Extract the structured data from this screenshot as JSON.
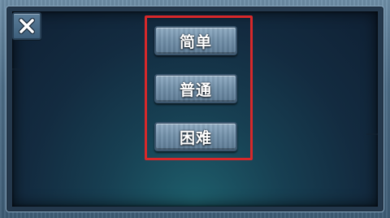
{
  "dialog": {
    "close_icon": "close-x-icon",
    "options": [
      {
        "label": "简单"
      },
      {
        "label": "普通"
      },
      {
        "label": "困难"
      }
    ]
  },
  "colors": {
    "highlight_border": "#d8282a",
    "button_stone": "#7391aa",
    "panel_glow": "#1e5f6c"
  }
}
